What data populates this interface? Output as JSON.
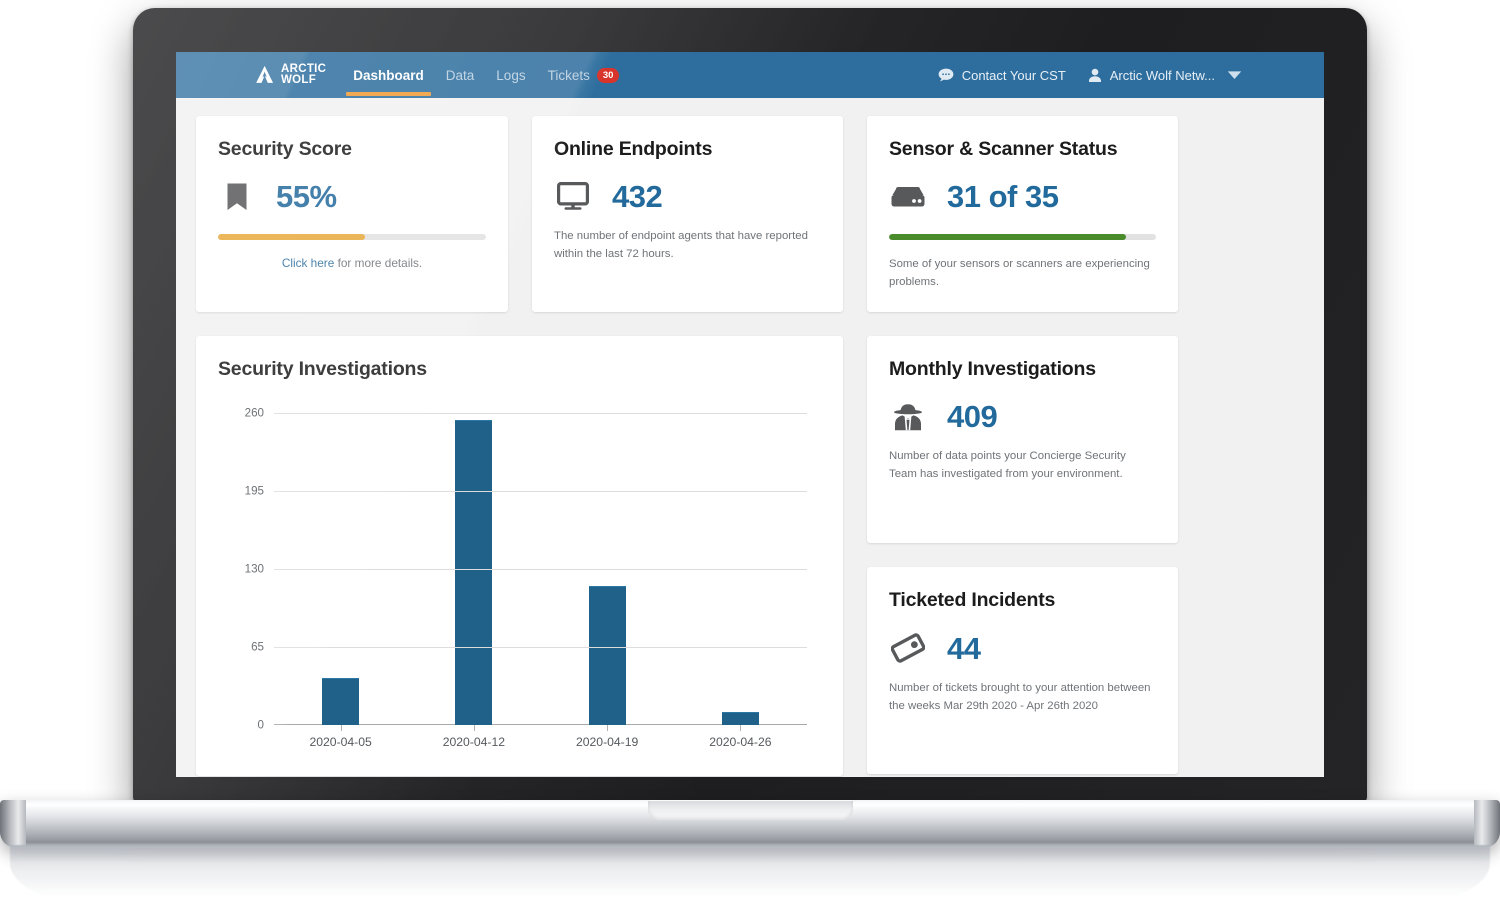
{
  "app": {
    "brand": {
      "line1": "ARCTIC",
      "line2": "WOLF",
      "icon": "mountain-logo-icon"
    },
    "nav_items": [
      {
        "label": "Dashboard",
        "active": true
      },
      {
        "label": "Data",
        "active": false
      },
      {
        "label": "Logs",
        "active": false
      },
      {
        "label": "Tickets",
        "active": false,
        "badge": "30"
      }
    ],
    "nav_right": {
      "contact_label": "Contact Your CST",
      "contact_icon": "chat-bubble-icon",
      "account_label": "Arctic Wolf Netw...",
      "account_icon": "user-icon",
      "caret_icon": "chevron-down-icon"
    },
    "colors": {
      "navbar": "#2e6e9e",
      "accent_orange": "#ef9a36",
      "badge_red": "#d9342b",
      "value_blue": "#236a9c",
      "bar_blue": "#1f6189",
      "progress_green": "#4a8b2c",
      "page_bg": "#f1f1f1"
    }
  },
  "cards": {
    "security_score": {
      "title": "Security Score",
      "icon": "bookmark-icon",
      "value": "55%",
      "progress_percent": 55,
      "progress_color": "#e8a93c",
      "link_text": "Click here",
      "note_suffix": " for more details."
    },
    "online_endpoints": {
      "title": "Online Endpoints",
      "icon": "monitor-icon",
      "value": "432",
      "note": "The number of endpoint agents that have reported within the last 72 hours."
    },
    "sensor_scanner": {
      "title": "Sensor & Scanner Status",
      "icon": "server-icon",
      "value": "31 of 35",
      "progress_percent": 88.6,
      "progress_color": "#4a8b2c",
      "note": "Some of your sensors or scanners are experiencing problems."
    },
    "monthly_investigations": {
      "title": "Monthly Investigations",
      "icon": "detective-icon",
      "value": "409",
      "note": "Number of data points your Concierge Security Team has investigated from your environment."
    },
    "ticketed_incidents": {
      "title": "Ticketed Incidents",
      "icon": "ticket-icon",
      "value": "44",
      "note": "Number of tickets brought to your attention between the weeks Mar 29th 2020 - Apr 26th 2020"
    }
  },
  "chart_data": {
    "type": "bar",
    "title": "Security Investigations",
    "categories": [
      "2020-04-05",
      "2020-04-12",
      "2020-04-19",
      "2020-04-26"
    ],
    "values": [
      38,
      253,
      115,
      10
    ],
    "series": [
      {
        "name": "Investigations",
        "values": [
          38,
          253,
          115,
          10
        ]
      }
    ],
    "xlabel": "",
    "ylabel": "",
    "ylim": [
      0,
      260
    ],
    "yticks": [
      0,
      65,
      130,
      195,
      260
    ],
    "ytick_labels": [
      "0",
      "65",
      "130",
      "195",
      "260"
    ],
    "grid": true,
    "legend": false,
    "bar_color": "#1f6189"
  }
}
